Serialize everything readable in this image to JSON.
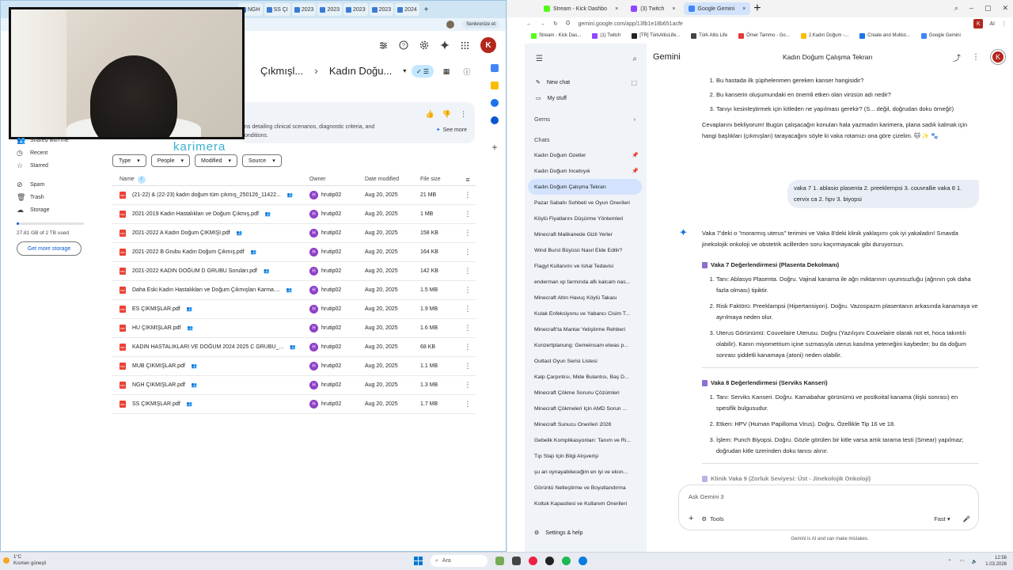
{
  "left_browser": {
    "tabs": [
      "NGH",
      "SS ÇI",
      "2023",
      "2023",
      "2023",
      "2023",
      "2024"
    ],
    "profile_label": "Senkronize et",
    "profile_letter": "K"
  },
  "drive": {
    "overlay_brand": "karimera",
    "breadcrumb": [
      "Çıkmışl...",
      "Kadın Doğu..."
    ],
    "ai_card_text_1": "ns detailing clinical scenarios, diagnostic criteria, and",
    "ai_card_text_2": "onditions.",
    "see_more": "See more",
    "sidebar": [
      {
        "label": "Shared with me",
        "icon": "people-icon"
      },
      {
        "label": "Recent",
        "icon": "clock-icon"
      },
      {
        "label": "Starred",
        "icon": "star-icon"
      },
      {
        "label": "Spam",
        "icon": "spam-icon"
      },
      {
        "label": "Trash",
        "icon": "trash-icon"
      },
      {
        "label": "Storage",
        "icon": "cloud-icon"
      }
    ],
    "storage_text": "27.81 GB of 2 TB used",
    "storage_fraction": 0.014,
    "get_storage": "Get more storage",
    "filters": [
      "Type",
      "People",
      "Modified",
      "Source"
    ],
    "columns": {
      "name": "Name",
      "owner": "Owner",
      "date": "Date modified",
      "size": "File size"
    },
    "files": [
      {
        "name": "(21-22) & (22-23) kadın doğum tüm çıkmış_250126_11422...",
        "owner": "hrutip02",
        "date": "Aug 20, 2025",
        "size": "21 MB"
      },
      {
        "name": "2021-2019 Kadın Hastalıkları ve Doğum Çıkmış.pdf",
        "owner": "hrutip02",
        "date": "Aug 20, 2025",
        "size": "1 MB"
      },
      {
        "name": "2021-2022 A Kadın Doğum ÇIKMIŞI.pdf",
        "owner": "hrutip02",
        "date": "Aug 20, 2025",
        "size": "158 KB"
      },
      {
        "name": "2021-2022 B Grubu Kadın Doğum Çıkmış.pdf",
        "owner": "hrutip02",
        "date": "Aug 20, 2025",
        "size": "164 KB"
      },
      {
        "name": "2021-2022 KADIN DOĞUM D GRUBU Soruları.pdf",
        "owner": "hrutip02",
        "date": "Aug 20, 2025",
        "size": "142 KB"
      },
      {
        "name": "Daha Eski Kadın Hastalıkları ve Doğum Çıkmışları Karma....",
        "owner": "hrutip02",
        "date": "Aug 20, 2025",
        "size": "1.5 MB"
      },
      {
        "name": "ES ÇIKMIŞLAR.pdf",
        "owner": "hrutip02",
        "date": "Aug 20, 2025",
        "size": "1.9 MB"
      },
      {
        "name": "HÜ ÇIKMIŞLAR.pdf",
        "owner": "hrutip02",
        "date": "Aug 20, 2025",
        "size": "1.6 MB"
      },
      {
        "name": "KADIN HASTALIKLARI VE DOĞUM 2024 2025 C GRUBU_...",
        "owner": "hrutip02",
        "date": "Aug 20, 2025",
        "size": "68 KB"
      },
      {
        "name": "MUB ÇIKMIŞLAR.pdf",
        "owner": "hrutip02",
        "date": "Aug 20, 2025",
        "size": "1.1 MB"
      },
      {
        "name": "NGH ÇIKMIŞLAR.pdf",
        "owner": "hrutip02",
        "date": "Aug 20, 2025",
        "size": "1.3 MB"
      },
      {
        "name": "SS ÇIKMIŞLAR.pdf",
        "owner": "hrutip02",
        "date": "Aug 20, 2025",
        "size": "1.7 MB"
      }
    ]
  },
  "right_browser": {
    "tabs": [
      {
        "label": "Stream - Kick Dashbo",
        "color": "#53fc18"
      },
      {
        "label": "(3) Twitch",
        "color": "#9146ff"
      },
      {
        "label": "Google Gemini",
        "color": "#4285f4"
      }
    ],
    "url": "gemini.google.com/app/13fb1e18b651acfe",
    "ai_label": "AI",
    "bookmarks": [
      {
        "label": "Stream - Kick Das...",
        "color": "#53fc18"
      },
      {
        "label": "(1) Twitch",
        "color": "#9146ff"
      },
      {
        "label": "[TR] TürkAltisLife...",
        "color": "#222"
      },
      {
        "label": "Türk Altis Life",
        "color": "#444"
      },
      {
        "label": "Ömer Tammo - Go...",
        "color": "#e53935"
      },
      {
        "label": "2.Kadın Doğum -...",
        "color": "#fbbc04"
      },
      {
        "label": "Create and Multist...",
        "color": "#1a73e8"
      },
      {
        "label": "Google Gemini",
        "color": "#4285f4"
      }
    ]
  },
  "gemini": {
    "brand": "Gemini",
    "title": "Kadın Doğum Çalışma Tekrarı",
    "new_chat": "New chat",
    "my_stuff": "My stuff",
    "gems": "Gems",
    "chats_label": "Chats",
    "chats": [
      {
        "label": "Kadın Doğum Özetler",
        "pinned": true
      },
      {
        "label": "Kadın Doğum İncebıyık",
        "pinned": true
      },
      {
        "label": "Kadın Doğum Çalışma Tekrarı",
        "pinned": false
      },
      {
        "label": "Pazar Sabahı Sohbeti ve Oyun Önerileri",
        "pinned": false
      },
      {
        "label": "Köylü Fiyatlarını Düşürme Yöntemleri",
        "pinned": false
      },
      {
        "label": "Minecraft Malikanede Gizli Yerler",
        "pinned": false
      },
      {
        "label": "Wind Burst Büyüsü Nasıl Elde Edilir?",
        "pinned": false
      },
      {
        "label": "Flagyl Kullanımı ve İshal Tedavisi",
        "pinned": false
      },
      {
        "label": "enderman xp farmında afk kalcam nas...",
        "pinned": false
      },
      {
        "label": "Minecraft Altın Havuç Köylü Takası",
        "pinned": false
      },
      {
        "label": "Kulak Enfeksiyonu ve Yabancı Cisim T...",
        "pinned": false
      },
      {
        "label": "Minecraft'ta Mantar Yetiştirme Rehberi",
        "pinned": false
      },
      {
        "label": "Konzertplanung: Gemeinsam etwas p...",
        "pinned": false
      },
      {
        "label": "Outlast Oyun Serisi Listesi",
        "pinned": false
      },
      {
        "label": "Kalp Çarpıntısı, Mide Bulantısı, Baş D...",
        "pinned": false
      },
      {
        "label": "Minecraft Çökme Sorunu Çözümleri",
        "pinned": false
      },
      {
        "label": "Minecraft Çökmeleri İçin AMD Sorun ...",
        "pinned": false
      },
      {
        "label": "Minecraft Sunucu Önerileri 2026",
        "pinned": false
      },
      {
        "label": "Gebelik Komplikasyonları: Tanım ve Ri...",
        "pinned": false
      },
      {
        "label": "Tıp Stajı İçin Bilgi Alışverişi",
        "pinned": false
      },
      {
        "label": "şu an oynayabileceğim en iyi ve ekon...",
        "pinned": false
      },
      {
        "label": "Görüntü Netleştirme ve Boyutlandırma",
        "pinned": false
      },
      {
        "label": "Koltuk Kapasitesi ve Kullanım Önerileri",
        "pinned": false
      }
    ],
    "settings": "Settings & help",
    "questions": [
      "Bu hastada ilk şüphelenmen gereken kanser hangisidir?",
      "Bu kanserin oluşumundaki en önemli etken olan virüsün adı nedir?",
      "Tanıyı kesinleştirmek için kitleden ne yapılması gerekir? (S... değil, doğrudan doku örneği!)"
    ],
    "para1": "Cevaplarını bekliyorum! Bugün çalışacağın konuları hala yazmadın karimera, plana sadık kalmak için hangi başlıkları (çıkmışları) tarayacağını söyle ki vaka rotamızı ona göre çizelim. 🐱 ✨ 🐾",
    "user_message": "vaka 7 1. ablasio plasenta 2. preeklempsi 3. couvrallie vaka 8 1. cervix ca 2. hpv 3. biyopsi",
    "reply_intro": "Vaka 7'deki o \"morarmış uterus\" terimini ve Vaka 8'deki klinik yaklaşımı çok iyi yakaladın! Sınavda jinekolojik onkoloji ve obstetrik acillerden soru kaçırmayacak gibi duruyorsun.",
    "sec1_title": "Vaka 7 Değerlendirmesi (Plasenta Dekolmanı)",
    "sec1_items": [
      "Tanı: Ablasyo Plasenta. Doğru. Vajinal kanama ile ağrı miktarının uyumsuzluğu (ağrının çok daha fazla olması) tipiktir.",
      "Risk Faktörü: Preeklampsi (Hipertansiyon). Doğru. Vazospazm plasentanın arkasında kanamaya ve ayrılmaya neden olur.",
      "Uterus Görünümü: Couvelaire Uterusu. Doğru (Yazılışını Couvelaire olarak not et, hoca takıntılı olabilir). Kanın miyometrium içine sızmasıyla uterus kasılma yeteneğini kaybeder; bu da doğum sonrası şiddetli kanamaya (atoni) neden olabilir."
    ],
    "sec2_title": "Vaka 8 Değerlendirmesi (Serviks Kanseri)",
    "sec2_items": [
      "Tanı: Serviks Kanseri. Doğru. Karnabahar görünümü ve postkoital kanama (ilişki sonrası) en spesifik bulgusudur.",
      "Etken: HPV (Human Papilloma Virus). Doğru. Özellikle Tip 16 ve 18.",
      "İşlem: Punch Biyopsi. Doğru. Gözle görülen bir kitle varsa artık tarama testi (Smear) yapılmaz; doğrudan kitle üzerinden doku tanısı alınır."
    ],
    "sec3_title": "Klinik Vaka 9 (Zorluk Seviyesi: Üst - Jinekolojik Onkoloji)",
    "input_placeholder": "Ask Gemini 3",
    "tools": "Tools",
    "mode": "Fast",
    "disclaimer": "Gemini is AI and can make mistakes."
  },
  "taskbar": {
    "temp": "1°C",
    "weather": "Kısmen güneşli",
    "search": "Ara",
    "time": "12:58",
    "date": "1.03.2026"
  }
}
